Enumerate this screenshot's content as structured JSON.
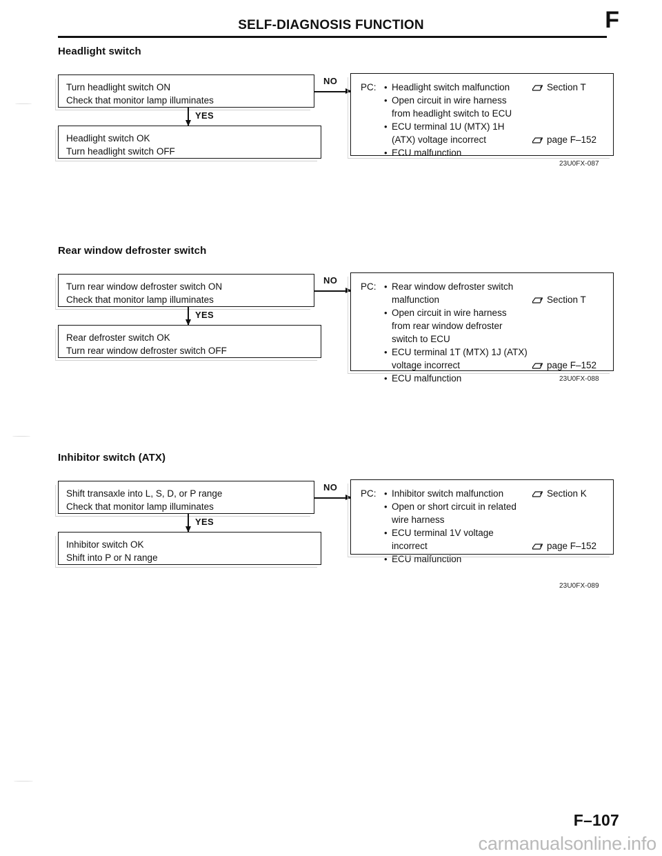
{
  "header": {
    "title": "SELF-DIAGNOSIS FUNCTION",
    "section_letter": "F"
  },
  "footer": {
    "page_number": "F–107",
    "watermark": "carmanualsonline.info"
  },
  "labels": {
    "yes": "YES",
    "no": "NO",
    "pc": "PC:",
    "bullet": "•"
  },
  "sections": [
    {
      "heading": "Headlight switch",
      "question_box": [
        "Turn headlight switch ON",
        "Check that monitor lamp illuminates"
      ],
      "result_box": [
        "Headlight switch OK",
        "Turn headlight switch OFF"
      ],
      "causes": [
        {
          "bullet": true,
          "text": "Headlight switch malfunction"
        },
        {
          "bullet": true,
          "text": "Open circuit in wire harness"
        },
        {
          "bullet": false,
          "text": "from headlight switch to ECU"
        },
        {
          "bullet": true,
          "text": "ECU terminal 1U (MTX) 1H"
        },
        {
          "bullet": false,
          "text": "(ATX) voltage incorrect"
        },
        {
          "bullet": true,
          "text": "ECU malfunction"
        }
      ],
      "refs": [
        {
          "text": "Section T",
          "row": 0
        },
        {
          "text": "page F–152",
          "row": 4
        }
      ],
      "figure_code": "23U0FX-087"
    },
    {
      "heading": "Rear window defroster switch",
      "question_box": [
        "Turn rear window defroster switch ON",
        "Check that monitor lamp illuminates"
      ],
      "result_box": [
        "Rear defroster switch OK",
        "Turn rear window defroster switch OFF"
      ],
      "causes": [
        {
          "bullet": true,
          "text": "Rear window defroster switch"
        },
        {
          "bullet": false,
          "text": "malfunction"
        },
        {
          "bullet": true,
          "text": "Open circuit in wire harness"
        },
        {
          "bullet": false,
          "text": "from rear window defroster"
        },
        {
          "bullet": false,
          "text": "switch to ECU"
        },
        {
          "bullet": true,
          "text": "ECU terminal 1T (MTX) 1J (ATX)"
        },
        {
          "bullet": false,
          "text": "voltage incorrect"
        },
        {
          "bullet": true,
          "text": "ECU malfunction"
        }
      ],
      "refs": [
        {
          "text": "Section T",
          "row": 1
        },
        {
          "text": "page F–152",
          "row": 6
        }
      ],
      "figure_code": "23U0FX-088"
    },
    {
      "heading": "Inhibitor switch (ATX)",
      "question_box": [
        "Shift transaxle into L, S, D, or P range",
        "Check that monitor lamp illuminates"
      ],
      "result_box": [
        "Inhibitor switch OK",
        "Shift into P or N range"
      ],
      "causes": [
        {
          "bullet": true,
          "text": "Inhibitor switch malfunction"
        },
        {
          "bullet": true,
          "text": "Open or short circuit in related"
        },
        {
          "bullet": false,
          "text": "wire harness"
        },
        {
          "bullet": true,
          "text": "ECU terminal 1V voltage"
        },
        {
          "bullet": false,
          "text": "incorrect"
        },
        {
          "bullet": true,
          "text": "ECU malfunction"
        }
      ],
      "refs": [
        {
          "text": "Section K",
          "row": 0
        },
        {
          "text": "page F–152",
          "row": 4
        }
      ],
      "figure_code": "23U0FX-089"
    }
  ]
}
